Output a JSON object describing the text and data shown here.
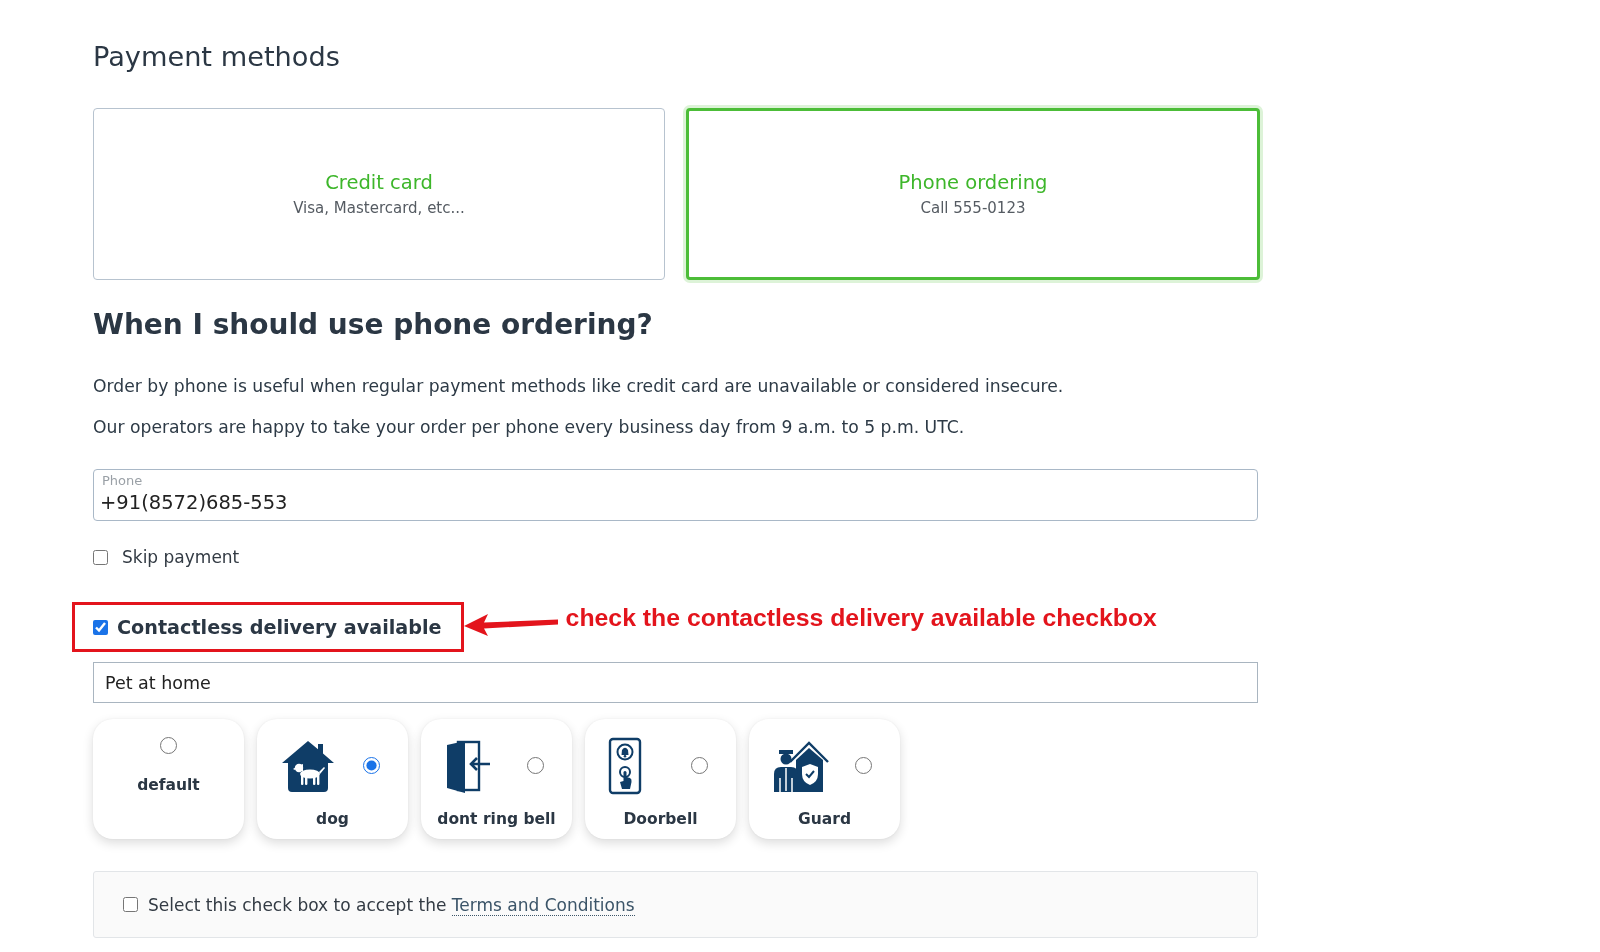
{
  "section_title": "Payment methods",
  "payment_methods": [
    {
      "title": "Credit card",
      "subtitle": "Visa, Mastercard, etc...",
      "selected": false
    },
    {
      "title": "Phone ordering",
      "subtitle": "Call 555-0123",
      "selected": true
    }
  ],
  "heading": "When I should use phone ordering?",
  "paragraphs": [
    "Order by phone is useful when regular payment methods like credit card are unavailable or considered insecure.",
    "Our operators are happy to take your order per phone every business day from 9 a.m. to 5 p.m. UTC."
  ],
  "phone_field": {
    "label": "Phone",
    "value": "+91(8572)685-553"
  },
  "skip_payment": {
    "label": "Skip payment",
    "checked": false
  },
  "contactless": {
    "label": "Contactless delivery available",
    "checked": true,
    "highlighted": true
  },
  "annotation": {
    "text": "check the contactless delivery available checkbox"
  },
  "delivery_note": {
    "value": "Pet at home"
  },
  "delivery_options": [
    {
      "label": "default",
      "kind": "plain",
      "selected": false
    },
    {
      "label": "dog",
      "kind": "icon",
      "selected": true
    },
    {
      "label": "dont ring bell",
      "kind": "icon",
      "selected": false
    },
    {
      "label": "Doorbell",
      "kind": "icon",
      "selected": false
    },
    {
      "label": "Guard",
      "kind": "icon",
      "selected": false
    }
  ],
  "terms": {
    "text": "Select this check box to accept the",
    "link": "Terms and Conditions",
    "checked": false
  }
}
